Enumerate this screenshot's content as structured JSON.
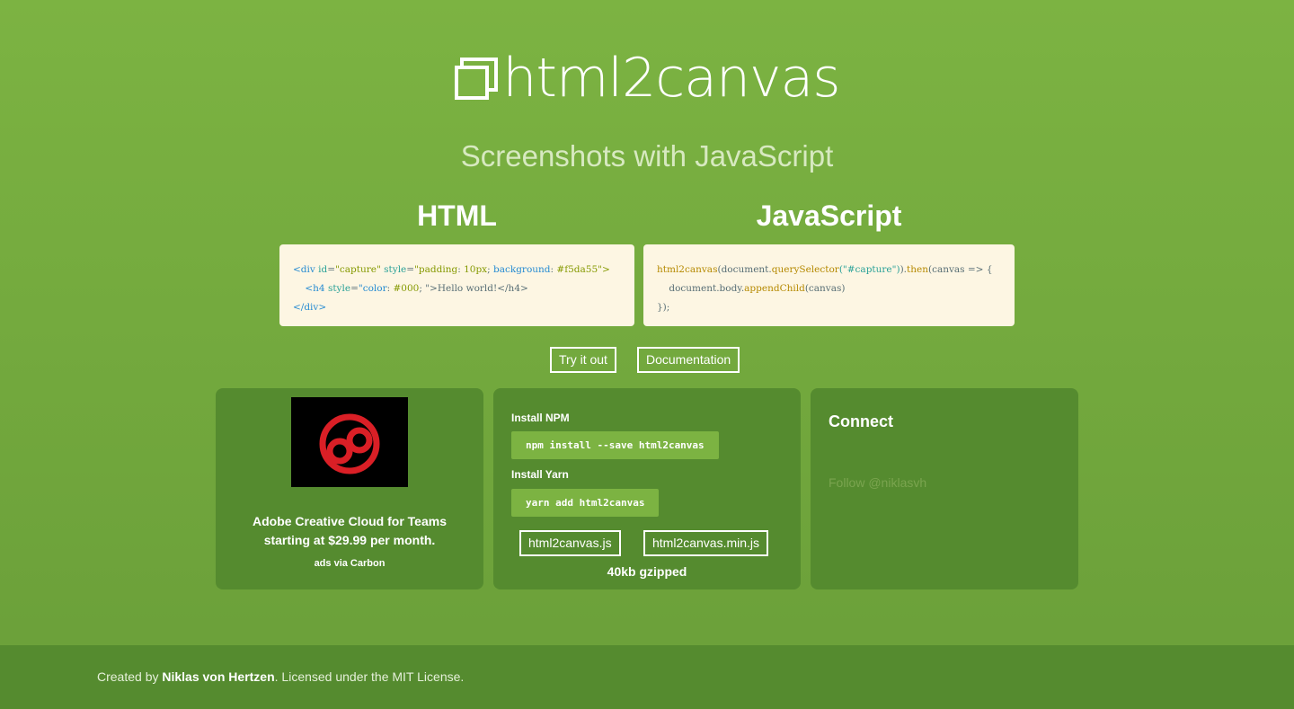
{
  "header": {
    "title": "html2canvas",
    "subtitle": "Screenshots with JavaScript"
  },
  "html_example": {
    "heading": "HTML",
    "line1": [
      "<div ",
      "id",
      "=",
      "\"capture\"",
      " style",
      "=",
      "\"padding",
      ": ",
      "10px",
      "; ",
      "background",
      ": ",
      "#f5da55",
      "\">"
    ],
    "line2": [
      "    <h4 ",
      "style",
      "=",
      "\"color",
      ": ",
      "#000",
      "; \">Hello world!</h4>"
    ],
    "line3": "</div>"
  },
  "js_example": {
    "heading": "JavaScript",
    "line1": [
      "html2canvas",
      "(document.",
      "querySelector",
      "(\"#capture\")",
      ").",
      "then",
      "(canvas => {"
    ],
    "line2": [
      "    document.body.",
      "appendChild",
      "(canvas)"
    ],
    "line3": "});"
  },
  "buttons": {
    "try": "Try it out",
    "docs": "Documentation"
  },
  "ad": {
    "text": "Adobe Creative Cloud for Teams starting at $29.99 per month.",
    "via": "ads via Carbon"
  },
  "install": {
    "npm_label": "Install NPM",
    "npm_cmd": "npm install --save html2canvas",
    "yarn_label": "Install Yarn",
    "yarn_cmd": "yarn add html2canvas",
    "dl1": "html2canvas.js",
    "dl2": "html2canvas.min.js",
    "size": "40kb gzipped"
  },
  "connect": {
    "title": "Connect",
    "follow": "Follow @niklasvh"
  },
  "footer": {
    "prefix": "Created by ",
    "author": "Niklas von Hertzen",
    "suffix": ". Licensed under the MIT License."
  },
  "colors": {
    "background": "#7cb342",
    "panel": "#558b2f",
    "code_bg": "#fdf6e3",
    "ad_logo": "#da1f26"
  }
}
